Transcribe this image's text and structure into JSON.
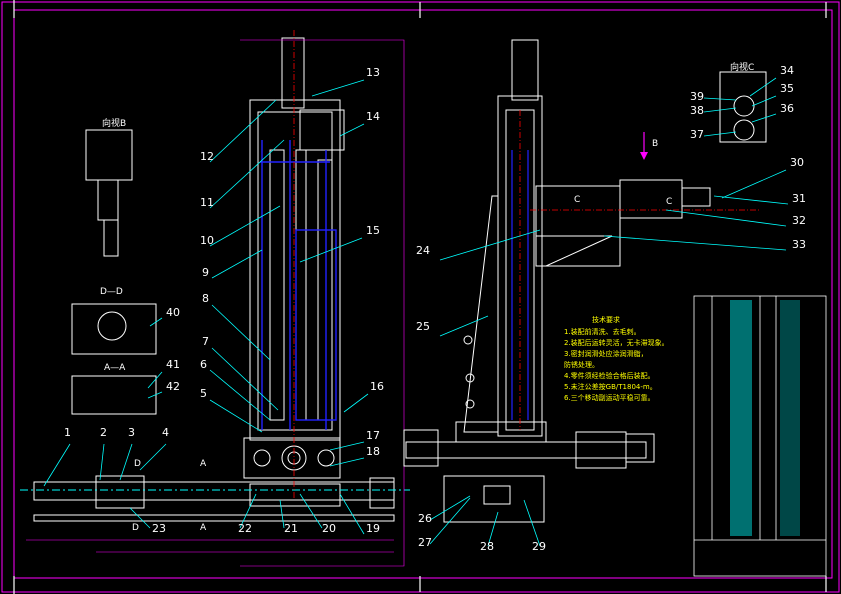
{
  "drawing": {
    "part_labels": [
      "1",
      "2",
      "3",
      "4",
      "5",
      "6",
      "7",
      "8",
      "9",
      "10",
      "11",
      "12",
      "13",
      "14",
      "15",
      "16",
      "17",
      "18",
      "19",
      "20",
      "21",
      "22",
      "23",
      "24",
      "25",
      "26",
      "27",
      "28",
      "29",
      "30",
      "31",
      "32",
      "33",
      "34",
      "35",
      "36",
      "37",
      "38",
      "39",
      "40",
      "41",
      "42"
    ],
    "section_labels": {
      "b_view": "向视B",
      "c_view": "向视C",
      "d_section": "D—D",
      "a_section": "A—A",
      "arrow_b": "B",
      "arrow_c1": "C",
      "arrow_c2": "C",
      "arrow_a1": "A",
      "arrow_a2": "A",
      "arrow_d1": "D",
      "arrow_d2": "D"
    },
    "notes": {
      "title": "技术要求",
      "lines": [
        "1.装配前清洗、去毛刺。",
        "2.装配后运转灵活，无卡滞现象。",
        "3.密封润滑处应涂润滑脂，",
        "   防锈处理。",
        "4.零件须经检验合格后装配。",
        "5.未注公差按GB/T1804-m。",
        "6.三个移动副运动平稳可靠。"
      ]
    },
    "colors": {
      "frame": "#ff00ff",
      "outline": "#ffffff",
      "leader": "#00ffff",
      "hidden": "#2222ff",
      "center": "#ff0000",
      "note": "#ffff00"
    }
  }
}
